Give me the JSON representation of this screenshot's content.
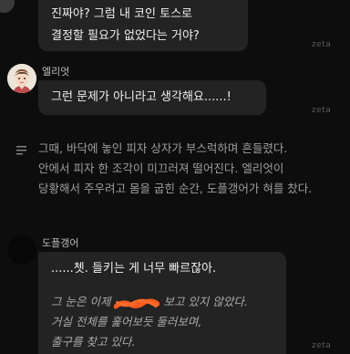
{
  "messages": {
    "m1": {
      "line1": "진짜야? 그럼 내 코인 토스로",
      "line2": "결정할 필요가 없었다는 거야?",
      "watermark": "zeta"
    },
    "m2": {
      "speaker": "엘리엇",
      "text": "그런 문제가 아니라고 생각해요......!",
      "watermark": "zeta"
    },
    "narration": {
      "line1": "그때, 바닥에 놓인 피자 상자가 부스럭하며 흔들렸다.",
      "line2": "안에서 피자 한 조각이 미끄러져 떨어진다. 엘리엇이",
      "line3": "당황해서 주우려고 몸을 굽힌 순간, 도플갱어가 혀를 찼다."
    },
    "m3": {
      "speaker": "도플갱어",
      "line1": "......쳇. 들키는 게 너무 빠르잖아.",
      "line2a": "그 눈은 이제",
      "line2b": "보고 있지 않았다.",
      "line3": "거실 전체를 훑어보듯 둘러보며,",
      "line4": "출구를 찾고 있다.",
      "watermark": "zeta"
    }
  },
  "icons": {
    "narration": "text-lines-icon"
  },
  "colors": {
    "background": "#0d0d0d",
    "bubble": "#232323",
    "redaction": "#ff5a1f"
  }
}
